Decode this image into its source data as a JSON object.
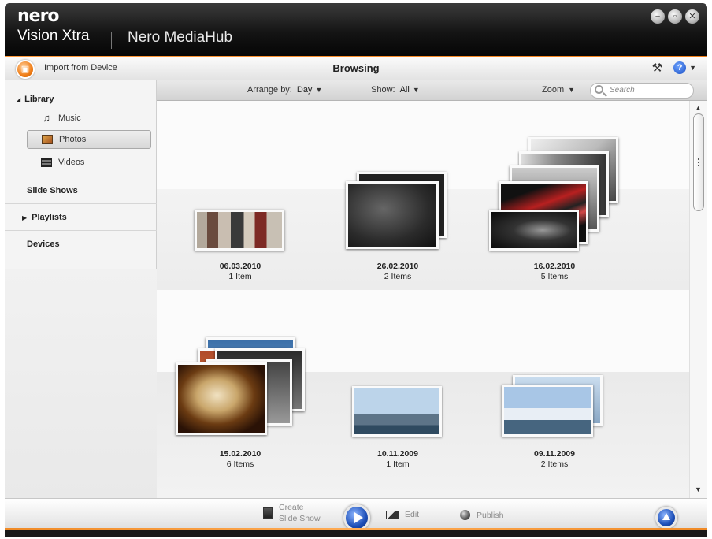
{
  "titlebar": {
    "logo": "nero",
    "product": "Vision Xtra",
    "hub": "Nero MediaHub",
    "window_buttons": [
      "minimize-icon",
      "maximize-icon",
      "close-icon"
    ]
  },
  "header": {
    "import_label": "Import from Device",
    "title": "Browsing",
    "tools_icon": "hammer-icon",
    "help_icon": "help-icon",
    "help_glyph": "?"
  },
  "sidebar": {
    "library": "Library",
    "items": [
      {
        "label": "Music",
        "icon": "music-note-icon",
        "selected": false
      },
      {
        "label": "Photos",
        "icon": "photo-icon",
        "selected": true
      },
      {
        "label": "Videos",
        "icon": "film-icon",
        "selected": false
      }
    ],
    "slide_shows": "Slide Shows",
    "playlists": "Playlists",
    "devices": "Devices"
  },
  "toolbar": {
    "arrange_label": "Arrange by:",
    "arrange_value": "Day",
    "show_label": "Show:",
    "show_value": "All",
    "zoom_label": "Zoom",
    "search_placeholder": "Search"
  },
  "albums": [
    {
      "date": "06.03.2010",
      "count": "1 Item"
    },
    {
      "date": "26.02.2010",
      "count": "2 Items"
    },
    {
      "date": "16.02.2010",
      "count": "5 Items"
    },
    {
      "date": "15.02.2010",
      "count": "6 Items"
    },
    {
      "date": "10.11.2009",
      "count": "1 Item"
    },
    {
      "date": "09.11.2009",
      "count": "2 Items"
    }
  ],
  "bottombar": {
    "create_line1": "Create",
    "create_line2": "Slide Show",
    "edit": "Edit",
    "publish": "Publish"
  },
  "colors": {
    "accent_orange": "#f07d16",
    "button_blue": "#1d4fb8",
    "titlebar": "#141414"
  }
}
